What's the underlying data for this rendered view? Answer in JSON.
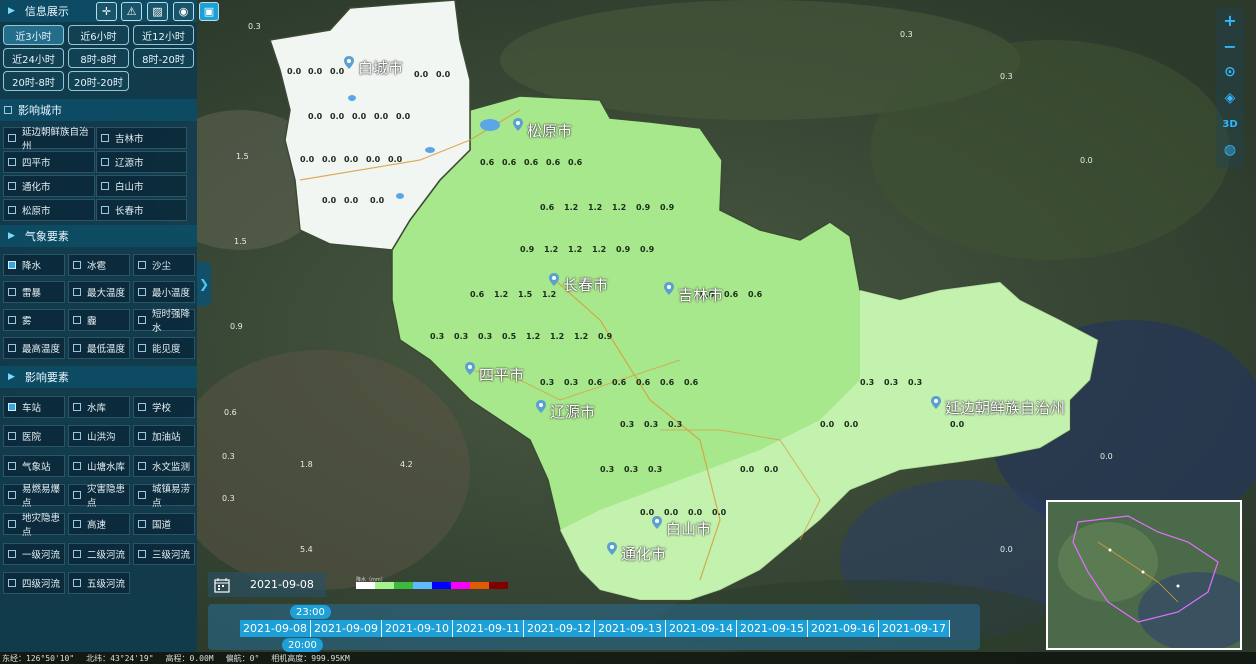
{
  "sidebar": {
    "info_title": "信息展示",
    "toolbar_icons": [
      "crosshair-icon",
      "warning-icon",
      "hatch-icon",
      "target-icon",
      "briefcase-icon"
    ],
    "time_buttons": [
      "近3小时",
      "近6小时",
      "近12小时",
      "近24小时",
      "8时-8时",
      "8时-20时",
      "20时-8时",
      "20时-20时"
    ],
    "active_time_button": "近3小时",
    "city_title": "影响城市",
    "cities": [
      "延边朝鲜族自治州",
      "吉林市",
      "四平市",
      "辽源市",
      "通化市",
      "白山市",
      "松原市",
      "长春市"
    ],
    "weather_title": "气象要素",
    "weather_items": [
      "降水",
      "冰雹",
      "沙尘",
      "雷暴",
      "最大温度",
      "最小温度",
      "雾",
      "霾",
      "短时强降水",
      "最高温度",
      "最低温度",
      "能见度"
    ],
    "weather_checked": "降水",
    "impact_title": "影响要素",
    "impact_items": [
      "车站",
      "水库",
      "学校",
      "医院",
      "山洪沟",
      "加油站",
      "气象站",
      "山塘水库",
      "水文监测",
      "易燃易爆点",
      "灾害隐患点",
      "城镇易涝点",
      "地灾隐患点",
      "高速",
      "国道",
      "一级河流",
      "二级河流",
      "三级河流",
      "四级河流",
      "五级河流"
    ],
    "impact_checked": "车站"
  },
  "map_labels": {
    "cities": [
      "白城市",
      "松原市",
      "长春市",
      "吉林市",
      "四平市",
      "辽源市",
      "延边朝鲜族自治州",
      "白山市",
      "通化市"
    ]
  },
  "legend": {
    "title": "降水（mm）",
    "colors": [
      "#ffffff",
      "#a6f28f",
      "#3dba3d",
      "#61b8ff",
      "#0000ff",
      "#fa00fa",
      "#e05a00",
      "#800000"
    ]
  },
  "timeline": {
    "current_date": "2021-09-08",
    "dates": [
      "2021-09-08",
      "2021-09-09",
      "2021-09-10",
      "2021-09-11",
      "2021-09-12",
      "2021-09-13",
      "2021-09-14",
      "2021-09-15",
      "2021-09-16",
      "2021-09-17"
    ],
    "time_top": "23:00",
    "time_bottom": "20:00"
  },
  "status": {
    "lon": "东经：126°50'10\"",
    "lat": "北纬：43°24'19\"",
    "alt": "高程：0.00M",
    "tilt": "偏航：0°",
    "cam": "相机高度：999.95KM"
  },
  "colors": {
    "panel": "#0e3a4e",
    "accent": "#1d9fd8",
    "province_light": "#a8e88c",
    "province_white": "#f2f6f2"
  }
}
